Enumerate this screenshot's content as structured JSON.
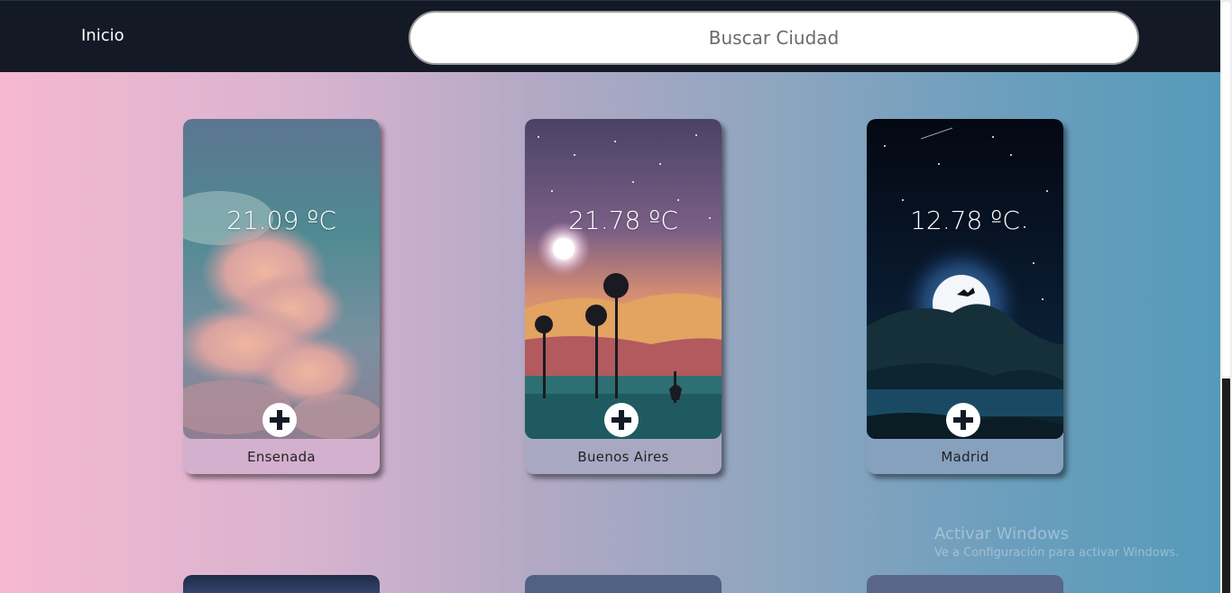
{
  "header": {
    "home_label": "Inicio",
    "search_placeholder": "Buscar Ciudad"
  },
  "cards": [
    {
      "city": "Ensenada",
      "temperature": "21.09 ºC",
      "add_icon": "plus-circle-icon"
    },
    {
      "city": "Buenos Aires",
      "temperature": "21.78 ºC",
      "add_icon": "plus-circle-icon"
    },
    {
      "city": "Madrid",
      "temperature": "12.78 ºC",
      "add_icon": "plus-circle-icon"
    }
  ],
  "watermark": {
    "title": "Activar Windows",
    "subtitle": "Ve a Configuración para activar Windows."
  },
  "colors": {
    "topbar": "#131a26",
    "gradient_start": "#f6b8d0",
    "gradient_end": "#549ab9"
  }
}
